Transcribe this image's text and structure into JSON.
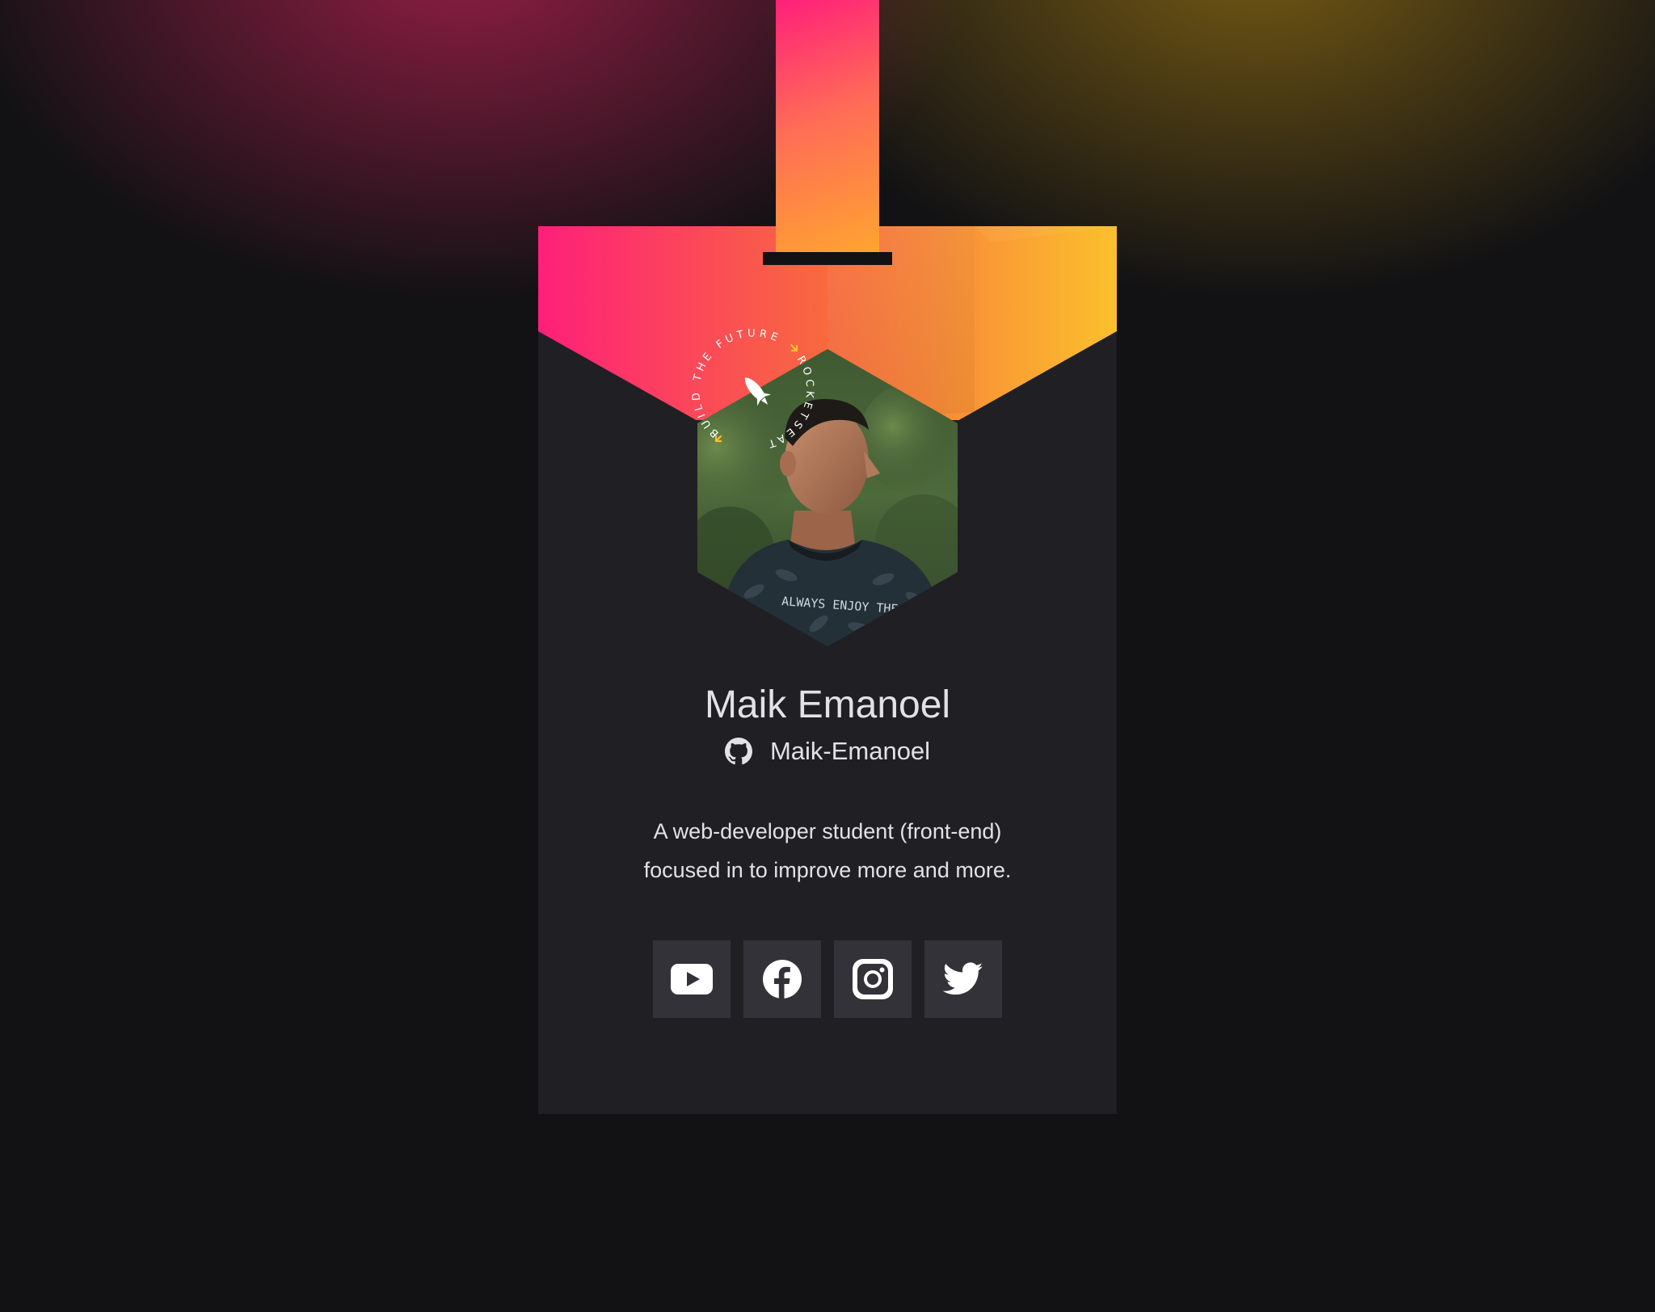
{
  "profile": {
    "name": "Maik Emanoel",
    "github_username": "Maik-Emanoel",
    "bio_line_1": "A web-developer student (front-end)",
    "bio_line_2": "focused in to improve more and more."
  },
  "stamp": {
    "text_left": "BUILD THE FUTURE",
    "text_right": "ROCKETSEAT"
  },
  "photo": {
    "shirt_text": "ALWAYS ENJOY THE"
  },
  "socials": [
    {
      "icon": "youtube-icon"
    },
    {
      "icon": "facebook-icon"
    },
    {
      "icon": "instagram-icon"
    },
    {
      "icon": "twitter-icon"
    }
  ],
  "colors": {
    "background": "#121214",
    "card": "#202024",
    "social_button": "#323238",
    "text": "#e1e1e6",
    "gradient_pink": "#ff1f7a",
    "gradient_orange": "#ff8a3a",
    "gradient_yellow": "#fbc02d"
  }
}
